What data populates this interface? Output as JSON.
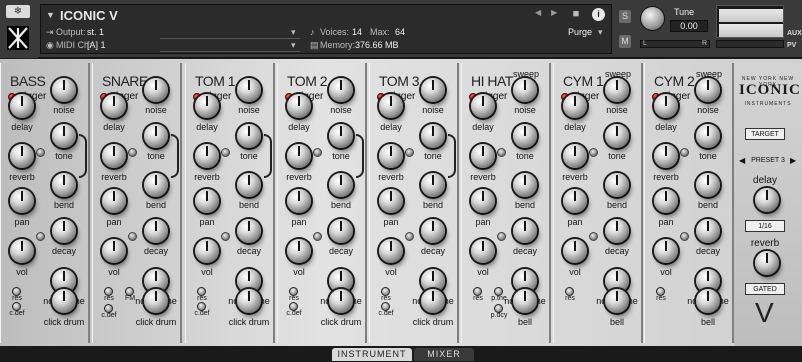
{
  "header": {
    "instrument_name": "ICONIC V",
    "output_label": "Output:",
    "output_value": "st. 1",
    "midi_label": "MIDI Ch:",
    "midi_value": "[A]  1",
    "voices_label": "Voices:",
    "voices_value": "14",
    "max_label": "Max:",
    "max_value": "64",
    "memory_label": "Memory:",
    "memory_value": "376.66 MB",
    "purge_label": "Purge",
    "s_label": "S",
    "m_label": "M",
    "tune_label": "Tune",
    "tune_value": "0.00",
    "pan_left": "L",
    "pan_right": "R",
    "aux_label": "AUX",
    "pv_label": "PV"
  },
  "panels": [
    {
      "name": "BASS",
      "trigger": "trigger",
      "knobs": [
        "noise",
        "delay",
        "tone",
        "reverb",
        "bend",
        "pan",
        "decay",
        "vol",
        "noise tone"
      ],
      "small": [
        "res",
        "c.def"
      ],
      "bottom": "click drum"
    },
    {
      "name": "SNARE",
      "trigger": "trigger",
      "knobs": [
        "noise",
        "delay",
        "tone",
        "reverb",
        "bend",
        "pan",
        "decay",
        "vol",
        "noise tone"
      ],
      "small": [
        "res",
        "FM",
        "c.def"
      ],
      "bottom": "click drum"
    },
    {
      "name": "TOM 1",
      "trigger": "trigger",
      "knobs": [
        "noise",
        "delay",
        "tone",
        "reverb",
        "bend",
        "pan",
        "decay",
        "vol",
        "noise tone"
      ],
      "small": [
        "res",
        "c.def"
      ],
      "bottom": "click drum"
    },
    {
      "name": "TOM 2",
      "trigger": "trigger",
      "knobs": [
        "noise",
        "delay",
        "tone",
        "reverb",
        "bend",
        "pan",
        "decay",
        "vol",
        "noise tone"
      ],
      "small": [
        "res",
        "c.def"
      ],
      "bottom": "click drum"
    },
    {
      "name": "TOM 3",
      "trigger": "trigger",
      "knobs": [
        "noise",
        "delay",
        "tone",
        "reverb",
        "bend",
        "pan",
        "decay",
        "vol",
        "noise tone"
      ],
      "small": [
        "res",
        "c.def"
      ],
      "bottom": "click drum"
    },
    {
      "name": "HI HAT",
      "trigger": "trigger",
      "top": "sweep",
      "knobs": [
        "noise",
        "delay",
        "tone",
        "reverb",
        "bend",
        "pan",
        "decay",
        "vol",
        "noise tone"
      ],
      "small": [
        "res",
        "p.tne",
        "p.dcy"
      ],
      "bottom": "bell"
    },
    {
      "name": "CYM 1",
      "trigger": "trigger",
      "top": "sweep",
      "knobs": [
        "noise",
        "delay",
        "tone",
        "reverb",
        "bend",
        "pan",
        "decay",
        "vol",
        "noise tone"
      ],
      "small": [
        "res"
      ],
      "bottom": "bell"
    },
    {
      "name": "CYM 2",
      "trigger": "trigger",
      "top": "sweep",
      "knobs": [
        "noise",
        "delay",
        "tone",
        "reverb",
        "bend",
        "pan",
        "decay",
        "vol",
        "noise tone"
      ],
      "small": [
        "res"
      ],
      "bottom": "bell"
    }
  ],
  "right_panel": {
    "brand_top": "NEW YORK NEW YORK",
    "logo": "ICONIC",
    "brand_sub": "INSTRUMENTS",
    "target_button": "TARGET",
    "preset_label": "PRESET 3",
    "delay_label": "delay",
    "delay_value": "1/16",
    "reverb_label": "reverb",
    "reverb_value": "GATED",
    "version_symbol": "V"
  },
  "footer": {
    "tab_instrument": "INSTRUMENT",
    "tab_mixer": "MIXER"
  }
}
